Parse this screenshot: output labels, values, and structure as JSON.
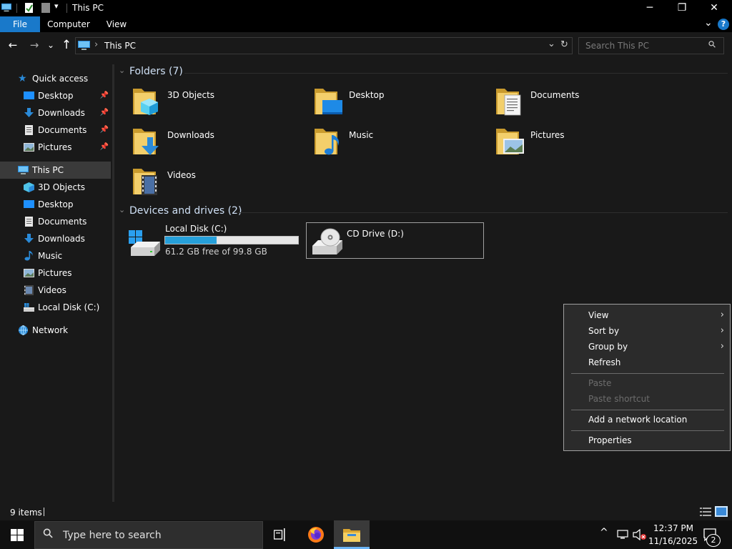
{
  "window": {
    "title": "This PC",
    "minimize_glyph": "─",
    "restore_glyph": "❐",
    "close_glyph": "✕"
  },
  "ribbon": {
    "tabs": [
      {
        "label": "File"
      },
      {
        "label": "Computer"
      },
      {
        "label": "View"
      }
    ],
    "help_glyph": "?",
    "expand_glyph": "⌄"
  },
  "address": {
    "back_glyph": "←",
    "forward_glyph": "→",
    "recent_glyph": "⌄",
    "up_glyph": "↑",
    "separator": "›",
    "path": "This PC",
    "search_placeholder": "Search This PC",
    "search_glyph": "⚲",
    "dropdown_glyph": "⌄",
    "refresh_glyph": "↻"
  },
  "nav": {
    "quick_access": {
      "label": "Quick access",
      "items": [
        {
          "label": "Desktop",
          "icon": "desktop-icon",
          "pinned": true
        },
        {
          "label": "Downloads",
          "icon": "downloads-icon",
          "pinned": true
        },
        {
          "label": "Documents",
          "icon": "documents-icon",
          "pinned": true
        },
        {
          "label": "Pictures",
          "icon": "pictures-icon",
          "pinned": true
        }
      ]
    },
    "this_pc": {
      "label": "This PC",
      "items": [
        {
          "label": "3D Objects",
          "icon": "3d-objects-icon"
        },
        {
          "label": "Desktop",
          "icon": "desktop-icon"
        },
        {
          "label": "Documents",
          "icon": "documents-icon"
        },
        {
          "label": "Downloads",
          "icon": "downloads-icon"
        },
        {
          "label": "Music",
          "icon": "music-icon"
        },
        {
          "label": "Pictures",
          "icon": "pictures-icon"
        },
        {
          "label": "Videos",
          "icon": "videos-icon"
        },
        {
          "label": "Local Disk (C:)",
          "icon": "drive-icon"
        }
      ]
    },
    "network": {
      "label": "Network"
    },
    "pin_glyph": "📌"
  },
  "content": {
    "folders_header": "Folders (7)",
    "folders": [
      {
        "label": "3D Objects",
        "icon": "3d-objects-folder-icon"
      },
      {
        "label": "Desktop",
        "icon": "desktop-folder-icon"
      },
      {
        "label": "Documents",
        "icon": "documents-folder-icon"
      },
      {
        "label": "Downloads",
        "icon": "downloads-folder-icon"
      },
      {
        "label": "Music",
        "icon": "music-folder-icon"
      },
      {
        "label": "Pictures",
        "icon": "pictures-folder-icon"
      },
      {
        "label": "Videos",
        "icon": "videos-folder-icon"
      }
    ],
    "drives_header": "Devices and drives (2)",
    "drives": [
      {
        "label": "Local Disk (C:)",
        "free_text": "61.2 GB free of 99.8 GB",
        "used_fraction": 0.387,
        "bar_color": "#26a0da"
      },
      {
        "label": "CD Drive (D:)"
      }
    ],
    "chevron_glyph": "⌄"
  },
  "status": {
    "items_count": "9 items"
  },
  "context_menu": {
    "items": [
      {
        "label": "View",
        "submenu": true,
        "disabled": false
      },
      {
        "label": "Sort by",
        "submenu": true,
        "disabled": false
      },
      {
        "label": "Group by",
        "submenu": true,
        "disabled": false
      },
      {
        "label": "Refresh",
        "submenu": false,
        "disabled": false
      },
      {
        "label": "Paste",
        "submenu": false,
        "disabled": true
      },
      {
        "label": "Paste shortcut",
        "submenu": false,
        "disabled": true
      },
      {
        "label": "Add a network location",
        "submenu": false,
        "disabled": false
      },
      {
        "label": "Properties",
        "submenu": false,
        "disabled": false
      }
    ],
    "arrow_glyph": "›"
  },
  "taskbar": {
    "search_placeholder": "Type here to search",
    "search_glyph": "⚲",
    "time": "12:37 PM",
    "date": "11/16/2025",
    "notification_count": "2",
    "tray_chevron": "^"
  },
  "colors": {
    "accent": "#1979ca",
    "folder_yellow": "#e8c25b",
    "progress": "#26a0da"
  }
}
